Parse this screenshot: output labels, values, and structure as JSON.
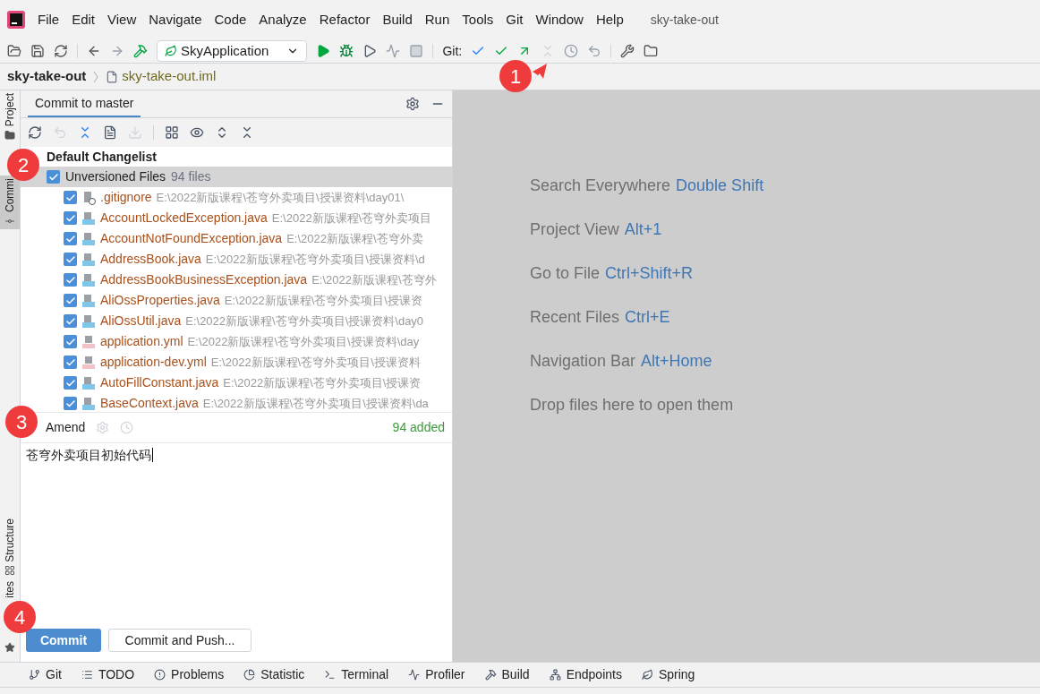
{
  "window": {
    "title": "sky-take-out"
  },
  "menu": [
    "File",
    "Edit",
    "View",
    "Navigate",
    "Code",
    "Analyze",
    "Refactor",
    "Build",
    "Run",
    "Tools",
    "Git",
    "Window",
    "Help"
  ],
  "toolbar": {
    "run_config": "SkyApplication",
    "git_label": "Git:"
  },
  "breadcrumb": [
    "sky-take-out",
    "sky-take-out.iml"
  ],
  "side_tabs": [
    {
      "label": "Project",
      "selected": false,
      "kind": "folder"
    },
    {
      "label": "Commi",
      "selected": true,
      "kind": "commit"
    },
    {
      "label": "Structure",
      "selected": false,
      "kind": "structure"
    },
    {
      "label": "ites",
      "selected": false,
      "kind": "star"
    }
  ],
  "commit_panel": {
    "tab": "Commit to master",
    "changelist": "Default Changelist",
    "group": {
      "label": "Unversioned Files",
      "count": "94 files",
      "checked": true
    },
    "files": [
      {
        "name": ".gitignore",
        "path": "E:\\2022新版课程\\苍穹外卖项目\\授课资料\\day01\\",
        "checked": true,
        "kind": "ignore"
      },
      {
        "name": "AccountLockedException.java",
        "path": "E:\\2022新版课程\\苍穹外卖项目",
        "checked": true,
        "kind": "java"
      },
      {
        "name": "AccountNotFoundException.java",
        "path": "E:\\2022新版课程\\苍穹外卖",
        "checked": true,
        "kind": "java"
      },
      {
        "name": "AddressBook.java",
        "path": "E:\\2022新版课程\\苍穹外卖项目\\授课资料\\d",
        "checked": true,
        "kind": "java"
      },
      {
        "name": "AddressBookBusinessException.java",
        "path": "E:\\2022新版课程\\苍穹外",
        "checked": true,
        "kind": "java"
      },
      {
        "name": "AliOssProperties.java",
        "path": "E:\\2022新版课程\\苍穹外卖项目\\授课资",
        "checked": true,
        "kind": "java"
      },
      {
        "name": "AliOssUtil.java",
        "path": "E:\\2022新版课程\\苍穹外卖项目\\授课资料\\day0",
        "checked": true,
        "kind": "java"
      },
      {
        "name": "application.yml",
        "path": "E:\\2022新版课程\\苍穹外卖项目\\授课资料\\day",
        "checked": true,
        "kind": "yml"
      },
      {
        "name": "application-dev.yml",
        "path": "E:\\2022新版课程\\苍穹外卖项目\\授课资料",
        "checked": true,
        "kind": "yml"
      },
      {
        "name": "AutoFillConstant.java",
        "path": "E:\\2022新版课程\\苍穹外卖项目\\授课资",
        "checked": true,
        "kind": "java"
      },
      {
        "name": "BaseContext.java",
        "path": "E:\\2022新版课程\\苍穹外卖项目\\授课资料\\da",
        "checked": true,
        "kind": "java"
      }
    ],
    "amend": "Amend",
    "added": "94 added",
    "message": "苍穹外卖项目初始代码",
    "buttons": [
      {
        "label": "Commit",
        "kind": "primary"
      },
      {
        "label": "Commit and Push...",
        "kind": "secondary"
      }
    ]
  },
  "hints": [
    {
      "text": "Search Everywhere",
      "shortcut": "Double Shift"
    },
    {
      "text": "Project View",
      "shortcut": "Alt+1"
    },
    {
      "text": "Go to File",
      "shortcut": "Ctrl+Shift+R"
    },
    {
      "text": "Recent Files",
      "shortcut": "Ctrl+E"
    },
    {
      "text": "Navigation Bar",
      "shortcut": "Alt+Home"
    },
    {
      "text": "Drop files here to open them"
    }
  ],
  "bottom_tabs": [
    "Git",
    "TODO",
    "Problems",
    "Statistic",
    "Terminal",
    "Profiler",
    "Build",
    "Endpoints",
    "Spring"
  ],
  "annotations": [
    "1",
    "2",
    "3",
    "4"
  ]
}
